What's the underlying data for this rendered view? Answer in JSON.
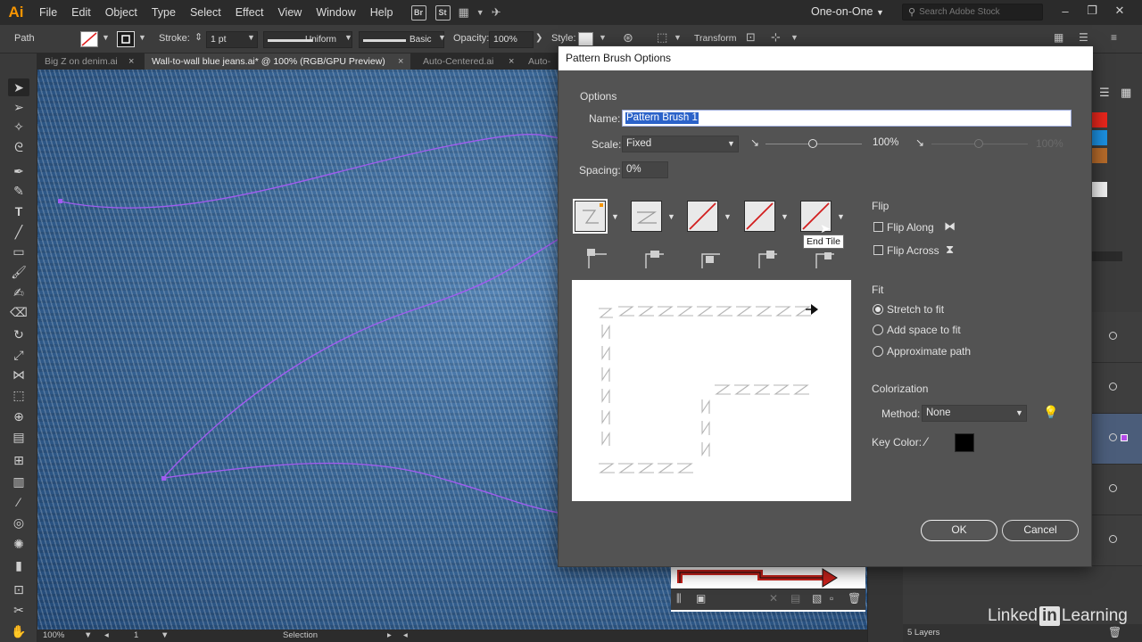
{
  "app": {
    "logo": "Ai",
    "menu": [
      "File",
      "Edit",
      "Object",
      "Type",
      "Select",
      "Effect",
      "View",
      "Window",
      "Help"
    ],
    "bridge_label": "Br",
    "stock_label": "St",
    "workspace": "One-on-One",
    "search_placeholder": "Search Adobe Stock"
  },
  "control_bar": {
    "selection_type": "Path",
    "stroke_label": "Stroke:",
    "stroke_value": "1 pt",
    "uniform_label": "Uniform",
    "basic_label": "Basic",
    "opacity_label": "Opacity:",
    "opacity_value": "100%",
    "style_label": "Style:",
    "transform_label": "Transform"
  },
  "tabs": [
    {
      "label": "Big Z on denim.ai",
      "active": false
    },
    {
      "label": "Wall-to-wall blue jeans.ai* @ 100% (RGB/GPU Preview)",
      "active": true
    },
    {
      "label": "Auto-Centered.ai",
      "active": false
    },
    {
      "label": "Auto-",
      "active": false
    }
  ],
  "status_bar": {
    "zoom": "100%",
    "artboard": "1",
    "tool": "Selection"
  },
  "layers_panel": {
    "count_label": "5 Layers"
  },
  "dialog": {
    "title": "Pattern Brush Options",
    "options_heading": "Options",
    "name_label": "Name:",
    "name_value": "Pattern Brush 1",
    "scale_label": "Scale:",
    "scale_method": "Fixed",
    "scale_value": "100%",
    "scale_value_2": "100%",
    "spacing_label": "Spacing:",
    "spacing_value": "0%",
    "tooltip": "End Tile",
    "flip_heading": "Flip",
    "flip_along": "Flip Along",
    "flip_across": "Flip Across",
    "fit_heading": "Fit",
    "fit_options": [
      "Stretch to fit",
      "Add space to fit",
      "Approximate path"
    ],
    "fit_selected": "Stretch to fit",
    "colorization_heading": "Colorization",
    "method_label": "Method:",
    "method_value": "None",
    "key_color_label": "Key Color:",
    "key_color": "#000000",
    "ok_label": "OK",
    "cancel_label": "Cancel"
  },
  "colors": {
    "accent_selection": "#2b62c9",
    "path_color": "#a05cf0",
    "swatch_red": "#e8261c",
    "swatch_blue": "#1b8fe0",
    "swatch_brown": "#b56a2a"
  },
  "watermark": {
    "left": "Linked",
    "mark": "in",
    "right": "Learning"
  }
}
